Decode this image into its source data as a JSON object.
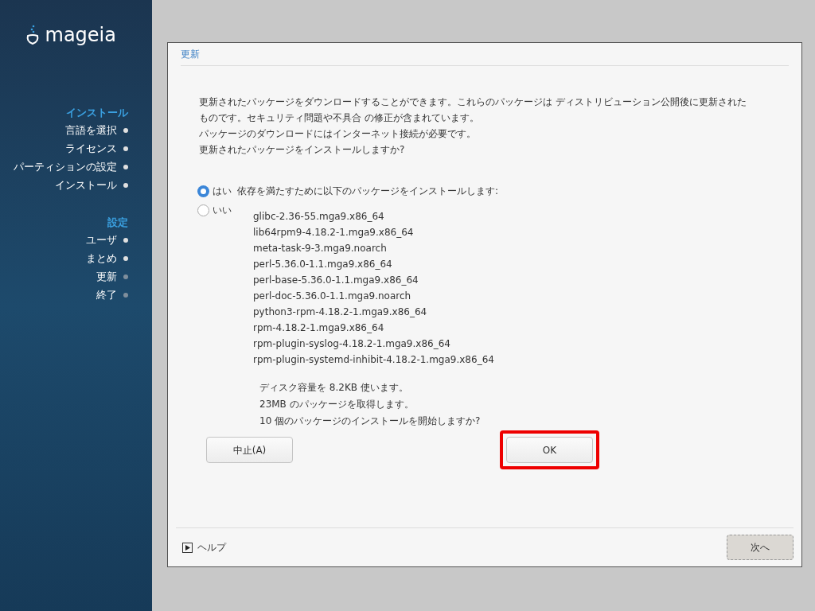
{
  "sidebar": {
    "logo_text": "mageia",
    "sections": [
      {
        "title": "インストール",
        "items": [
          {
            "label": "言語を選択",
            "done": true
          },
          {
            "label": "ライセンス",
            "done": true
          },
          {
            "label": "パーティションの設定",
            "done": true
          },
          {
            "label": "インストール",
            "done": true
          }
        ]
      },
      {
        "title": "設定",
        "items": [
          {
            "label": "ユーザ",
            "done": true
          },
          {
            "label": "まとめ",
            "done": true
          },
          {
            "label": "更新",
            "done": false
          },
          {
            "label": "終了",
            "done": false
          }
        ]
      }
    ]
  },
  "panel": {
    "title": "更新",
    "intro": [
      "更新されたパッケージをダウンロードすることができます。これらのパッケージは ディストリビューション公開後に更新された",
      "ものです。セキュリティ問題や不具合 の修正が含まれています。",
      "パッケージのダウンロードにはインターネット接続が必要です。",
      "更新されたパッケージをインストールしますか?"
    ],
    "options": [
      {
        "label": "はい",
        "selected": true
      },
      {
        "label": "いい",
        "selected": false
      }
    ],
    "help": "ヘルプ",
    "next_button": "次へ"
  },
  "dialog": {
    "message": "依存を満たすために以下のパッケージをインストールします:",
    "packages": [
      "glibc-2.36-55.mga9.x86_64",
      "lib64rpm9-4.18.2-1.mga9.x86_64",
      "meta-task-9-3.mga9.noarch",
      "perl-5.36.0-1.1.mga9.x86_64",
      "perl-base-5.36.0-1.1.mga9.x86_64",
      "perl-doc-5.36.0-1.1.mga9.noarch",
      "python3-rpm-4.18.2-1.mga9.x86_64",
      "rpm-4.18.2-1.mga9.x86_64",
      "rpm-plugin-syslog-4.18.2-1.mga9.x86_64",
      "rpm-plugin-systemd-inhibit-4.18.2-1.mga9.x86_64"
    ],
    "summary": [
      "ディスク容量を 8.2KB 使います。",
      "23MB のパッケージを取得します。",
      "10 個のパッケージのインストールを開始しますか?"
    ],
    "buttons": [
      {
        "label": "中止(A)",
        "highlighted": false
      },
      {
        "label": "OK",
        "highlighted": true
      }
    ]
  }
}
